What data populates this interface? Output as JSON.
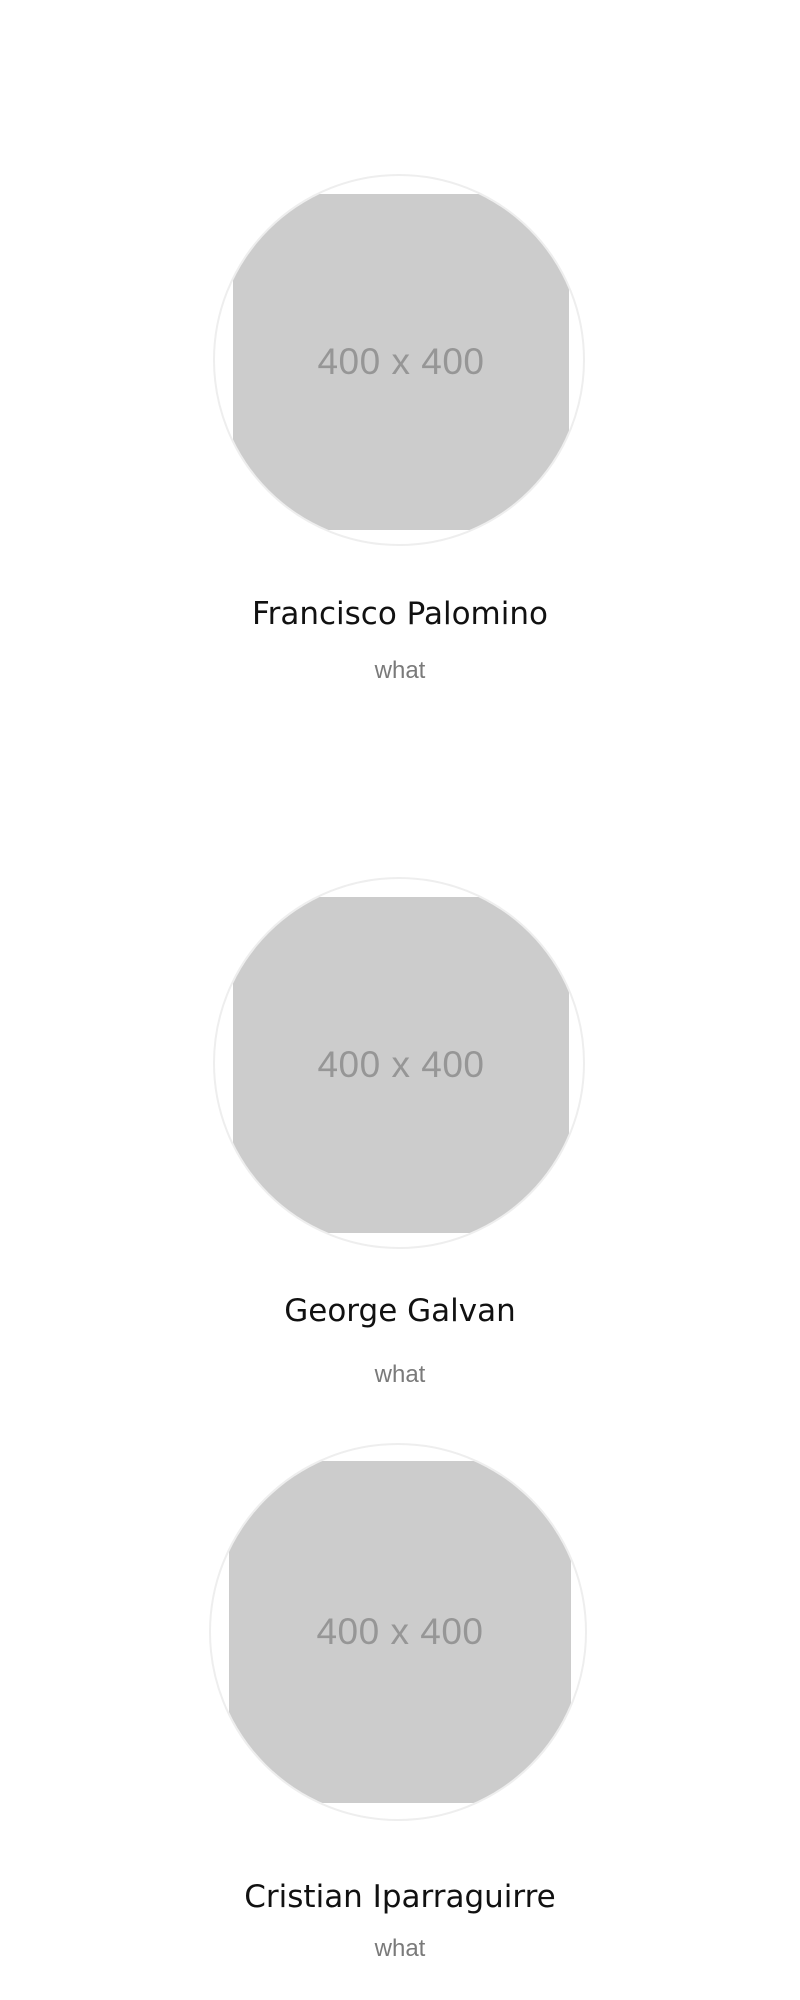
{
  "team": {
    "members": [
      {
        "image_label": "400 x 400",
        "name": "Francisco Palomino",
        "role": "what"
      },
      {
        "image_label": "400 x 400",
        "name": "George Galvan",
        "role": "what"
      },
      {
        "image_label": "400 x 400",
        "name": "Cristian Iparraguirre",
        "role": "what"
      }
    ]
  },
  "colors": {
    "placeholder_bg": "#cccccc",
    "placeholder_text": "#969696",
    "ring": "#eeeeee",
    "name_text": "#111111",
    "role_text": "#7a7a7a"
  }
}
